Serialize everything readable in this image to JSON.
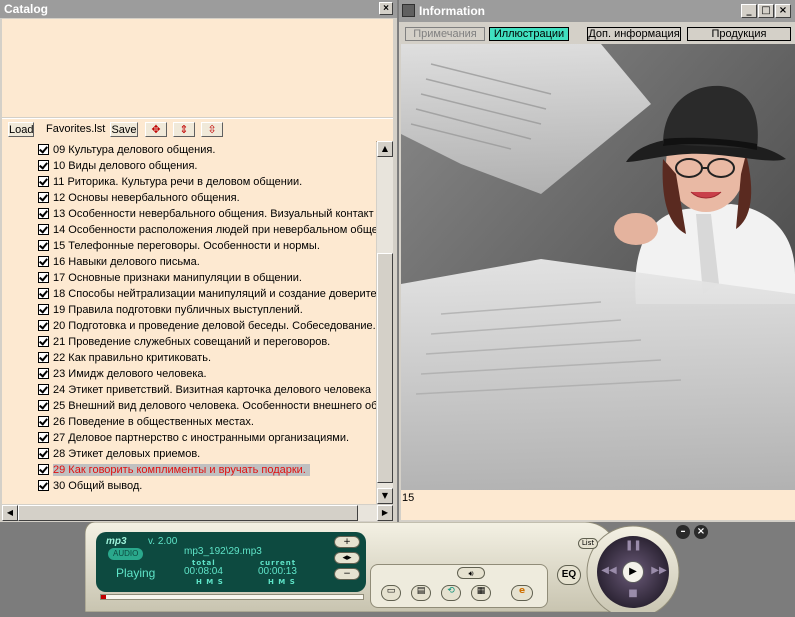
{
  "catalog": {
    "title": "Catalog",
    "close": "×",
    "toolbar": {
      "load": "Load",
      "list_name": "Favorites.lst",
      "save": "Save"
    },
    "items": [
      "09 Культура делового общения.",
      "10 Виды делового общения.",
      "11 Риторика. Культура речи в деловом общении.",
      "12 Основы невербального общения.",
      "13 Особенности невербального общения. Визуальный контакт",
      "14 Особенности расположения людей при невербальном обще",
      "15 Телефонные переговоры. Особенности и нормы.",
      "16 Навыки делового письма.",
      "17 Основные признаки манипуляции в общении.",
      "18 Способы нейтрализации манипуляций и создание доверите",
      "19 Правила подготовки публичных выступлений.",
      "20 Подготовка и проведение деловой беседы. Собеседование.",
      "21 Проведение служебных совещаний и переговоров.",
      "22 Как правильно критиковать.",
      "23 Имидж делового человека.",
      "24 Этикет приветствий. Визитная карточка делового человека",
      "25 Внешний вид делового человека. Особенности внешнего об",
      "26 Поведение в общественных местах.",
      "27 Деловое партнерство с иностранными организациями.",
      "28 Этикет деловых приемов.",
      "29 Как говорить комплименты и вручать подарки.",
      "30 Общий вывод."
    ],
    "selected_index": 20
  },
  "info": {
    "title": "Information",
    "tabs": [
      "Примечания",
      "Иллюстрации",
      "Доп. информация",
      "Продукция"
    ],
    "active_tab": 1,
    "status_text": "15"
  },
  "player": {
    "brand": "mp3",
    "mode": "AUDIO",
    "version": "v. 2.00",
    "track": "mp3_192\\29.mp3",
    "state": "Playing",
    "total_label": "total",
    "current_label": "current",
    "total_time": "00:08:04",
    "current_time": "00:00:13",
    "hms": "H M S",
    "eq": "EQ",
    "list_tag": "List",
    "vol_plus": "+",
    "vol_minus": "−",
    "seek_progress": 0.02
  },
  "colors": {
    "accent_tab": "#40e0c0",
    "panel": "#fde9d1",
    "selected_text": "#e01010"
  }
}
